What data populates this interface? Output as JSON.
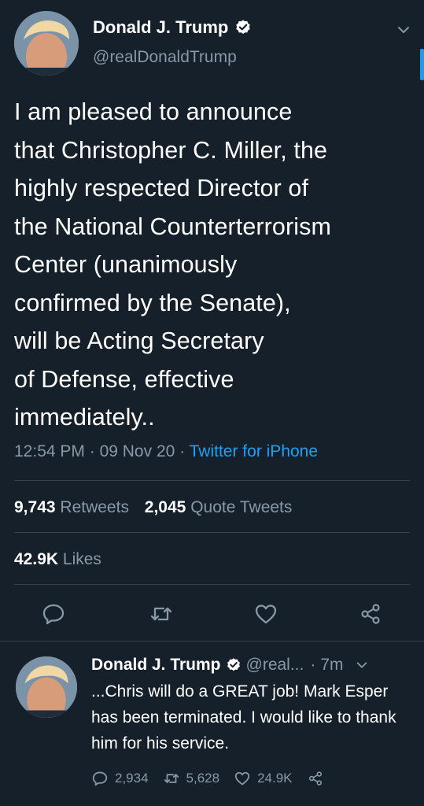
{
  "tweet": {
    "author_name": "Donald J. Trump",
    "author_handle": "@realDonaldTrump",
    "text": "I am pleased to announce\nthat Christopher C. Miller, the\nhighly respected Director of\nthe National Counterterrorism\nCenter (unanimously\nconfirmed by the Senate),\nwill be Acting Secretary\nof Defense, effective\nimmediately..",
    "time": "12:54 PM",
    "date": "09 Nov 20",
    "separator": "·",
    "source": "Twitter for iPhone",
    "retweets_count": "9,743",
    "retweets_label": "Retweets",
    "quotes_count": "2,045",
    "quotes_label": "Quote Tweets",
    "likes_count": "42.9K",
    "likes_label": "Likes",
    "icons": [
      "reply-icon",
      "retweet-icon",
      "like-icon",
      "share-icon",
      "verified-badge-icon",
      "chevron-down-icon"
    ]
  },
  "reply": {
    "author_name": "Donald J. Trump",
    "author_handle": "@real...",
    "separator": "·",
    "time_ago": "7m",
    "text": "...Chris will do a GREAT job! Mark Esper has been terminated. I would like to thank him for his service.",
    "reply_count": "2,934",
    "retweet_count": "5,628",
    "like_count": "24.9K"
  },
  "colors": {
    "background": "#15202b",
    "text": "#ffffff",
    "muted": "#8899a6",
    "link": "#1da1f2",
    "divider": "#38444d"
  }
}
